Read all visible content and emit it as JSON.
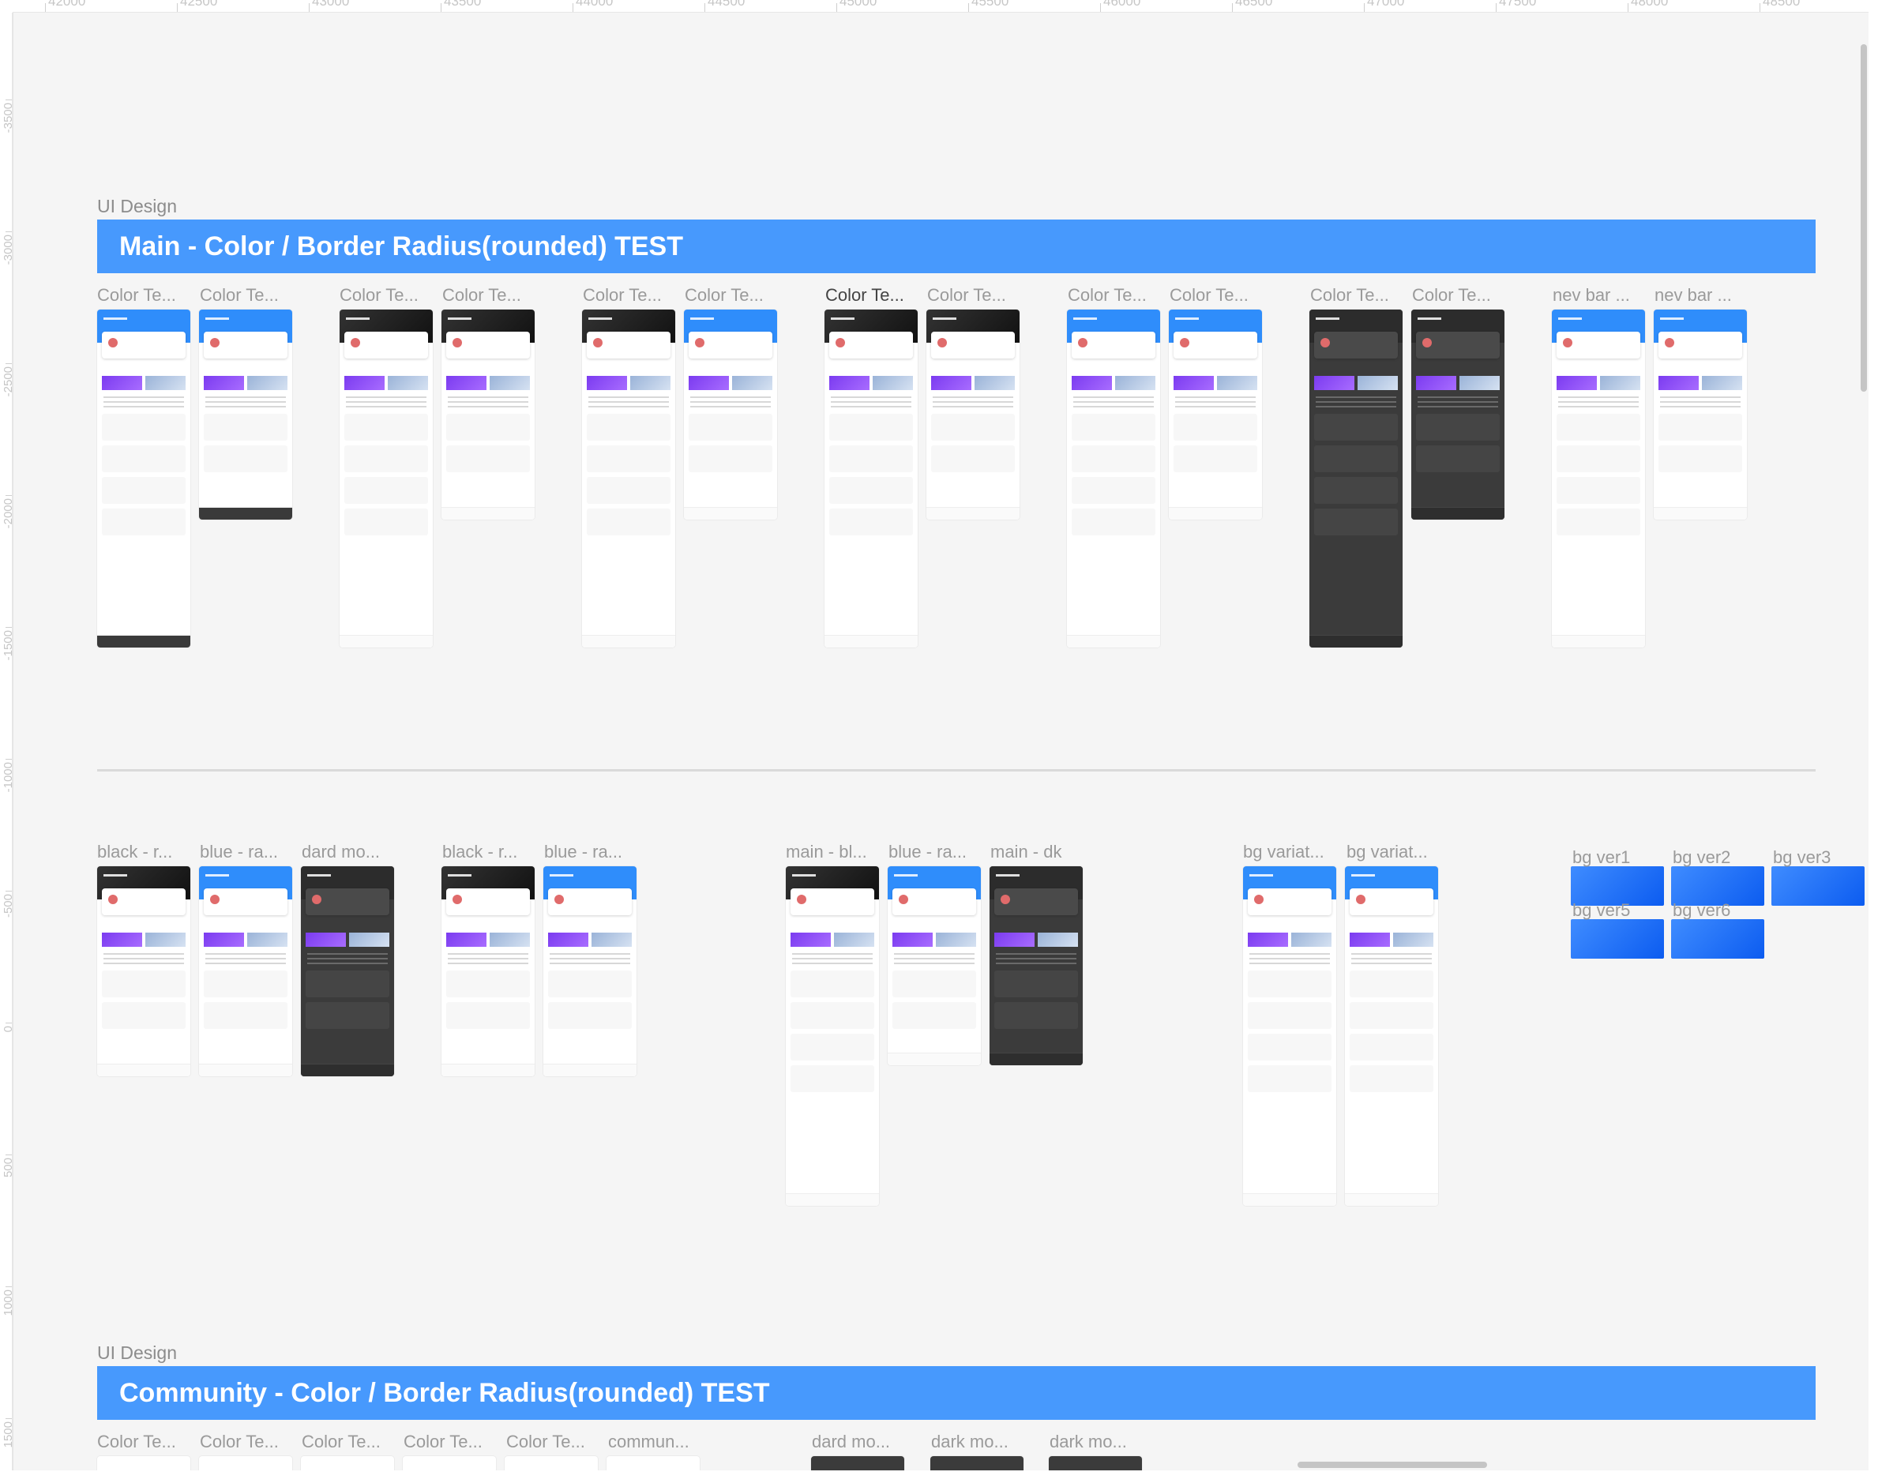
{
  "rulers": {
    "horizontal": [
      "42000",
      "42500",
      "43000",
      "43500",
      "44000",
      "44500",
      "45000",
      "45500",
      "46000",
      "46500",
      "47000",
      "47500",
      "48000",
      "48500"
    ],
    "vertical": [
      "-3500",
      "-3000",
      "-2500",
      "-2000",
      "-1500",
      "-1000",
      "-500",
      "0",
      "500",
      "1000",
      "1500"
    ]
  },
  "sections": [
    {
      "label": "UI Design",
      "banner": "Main - Color / Border Radius(rounded) TEST"
    },
    {
      "label": "UI Design",
      "banner": "Community - Color / Border Radius(rounded) TEST"
    }
  ],
  "row1_labels": [
    "Color Te...",
    "Color Te...",
    "Color Te...",
    "Color Te...",
    "Color Te...",
    "Color Te...",
    "Color Te...",
    "Color Te...",
    "Color Te...",
    "Color Te...",
    "Color Te...",
    "Color Te...",
    "nev bar ...",
    "nev bar ..."
  ],
  "row2_labels": [
    "black - r...",
    "blue - ra...",
    "dard mo...",
    "black - r...",
    "blue - ra...",
    "main - bl...",
    "blue - ra...",
    "main - dk",
    "bg variat...",
    "bg variat..."
  ],
  "bg_tiles": [
    "bg ver1",
    "bg ver2",
    "bg ver3",
    "bg ver5",
    "bg ver6"
  ],
  "row3_labels": [
    "Color Te...",
    "Color Te...",
    "Color Te...",
    "Color Te...",
    "Color Te...",
    "commun...",
    "dard mo...",
    "dark mo...",
    "dark mo..."
  ]
}
